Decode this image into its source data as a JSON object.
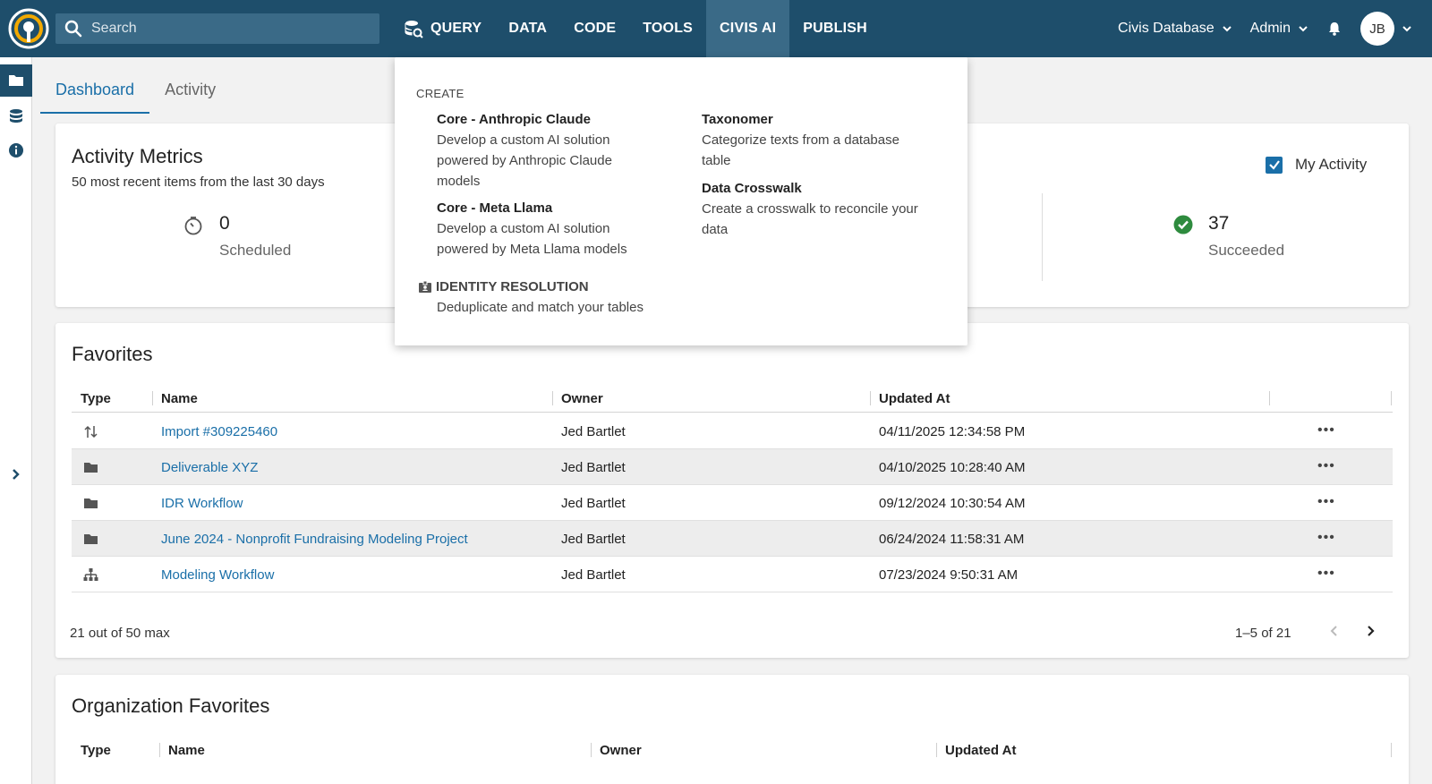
{
  "topbar": {
    "search_placeholder": "Search",
    "nav": [
      "QUERY",
      "DATA",
      "CODE",
      "TOOLS",
      "CIVIS AI",
      "PUBLISH"
    ],
    "active_nav": "CIVIS AI",
    "database": "Civis Database",
    "role": "Admin",
    "user_initials": "JB"
  },
  "tabs": [
    "Dashboard",
    "Activity"
  ],
  "metrics": {
    "title": "Activity Metrics",
    "subtitle": "50 most recent items from the last 30 days",
    "scheduled_value": "0",
    "scheduled_label": "Scheduled",
    "succeeded_value": "37",
    "succeeded_label": "Succeeded",
    "my_activity_label": "My Activity"
  },
  "favorites": {
    "title": "Favorites",
    "headers": [
      "Type",
      "Name",
      "Owner",
      "Updated At"
    ],
    "rows": [
      {
        "icon": "import-icon",
        "name": "Import #309225460",
        "owner": "Jed Bartlet",
        "updated": "04/11/2025 12:34:58 PM"
      },
      {
        "icon": "folder-icon",
        "name": "Deliverable XYZ",
        "owner": "Jed Bartlet",
        "updated": "04/10/2025 10:28:40 AM"
      },
      {
        "icon": "folder-icon",
        "name": "IDR Workflow",
        "owner": "Jed Bartlet",
        "updated": "09/12/2024 10:30:54 AM"
      },
      {
        "icon": "folder-icon",
        "name": "June 2024 - Nonprofit Fundraising Modeling Project",
        "owner": "Jed Bartlet",
        "updated": "06/24/2024 11:58:31 AM"
      },
      {
        "icon": "workflow-icon",
        "name": "Modeling Workflow",
        "owner": "Jed Bartlet",
        "updated": "07/23/2024 9:50:31 AM"
      }
    ],
    "footer": "21 out of 50 max",
    "pagination": "1–5 of 21",
    "more": "•••"
  },
  "org_favorites": {
    "title": "Organization Favorites",
    "headers": [
      "Type",
      "Name",
      "Owner",
      "Updated At"
    ]
  },
  "dropdown": {
    "header": "CREATE",
    "items": [
      {
        "title": "Core - Anthropic Claude",
        "desc": "Develop a custom AI solution powered by Anthropic Claude models"
      },
      {
        "title": "Core - Meta Llama",
        "desc": "Develop a custom AI solution powered by Meta Llama models"
      },
      {
        "title": "Taxonomer",
        "desc": "Categorize texts from a database table"
      },
      {
        "title": "Data Crosswalk",
        "desc": "Create a crosswalk to reconcile your data"
      }
    ],
    "identity_title": "IDENTITY RESOLUTION",
    "identity_desc": "Deduplicate and match your tables"
  },
  "colors": {
    "topbar": "#1e4e6b",
    "active_nav": "#3a6a87",
    "link": "#1a6fa8",
    "success": "#2e8b3e"
  }
}
